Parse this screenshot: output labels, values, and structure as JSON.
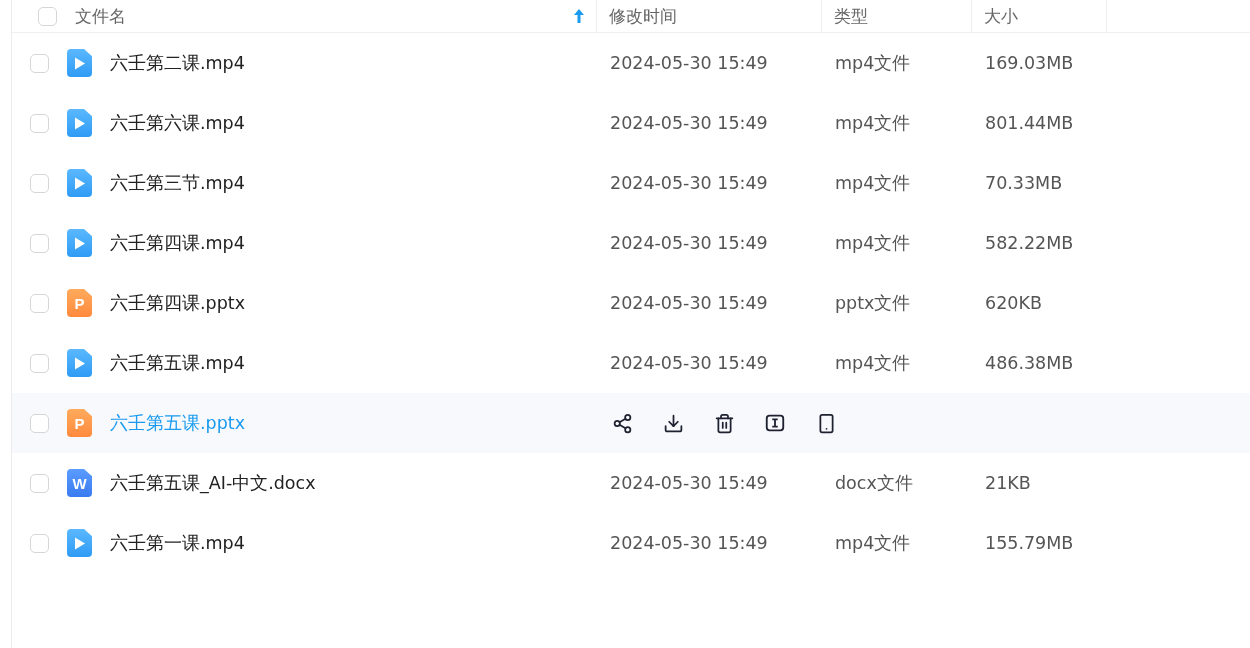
{
  "header": {
    "select_all": {
      "checked": false
    },
    "columns": [
      {
        "label": "文件名",
        "sorted": true
      },
      {
        "label": "修改时间",
        "sorted": false
      },
      {
        "label": "类型",
        "sorted": false
      },
      {
        "label": "大小",
        "sorted": false
      }
    ]
  },
  "files": [
    {
      "kind": "video",
      "name": "六壬第二课.mp4",
      "checked": false,
      "hovered": false,
      "modified": "2024-05-30 15:49",
      "type": "mp4文件",
      "size": "169.03MB"
    },
    {
      "kind": "video",
      "name": "六壬第六课.mp4",
      "checked": false,
      "hovered": false,
      "modified": "2024-05-30 15:49",
      "type": "mp4文件",
      "size": "801.44MB"
    },
    {
      "kind": "video",
      "name": "六壬第三节.mp4",
      "checked": false,
      "hovered": false,
      "modified": "2024-05-30 15:49",
      "type": "mp4文件",
      "size": "70.33MB"
    },
    {
      "kind": "video",
      "name": "六壬第四课.mp4",
      "checked": false,
      "hovered": false,
      "modified": "2024-05-30 15:49",
      "type": "mp4文件",
      "size": "582.22MB"
    },
    {
      "kind": "slides",
      "icon_letter": "P",
      "name": "六壬第四课.pptx",
      "checked": false,
      "hovered": false,
      "modified": "2024-05-30 15:49",
      "type": "pptx文件",
      "size": "620KB"
    },
    {
      "kind": "video",
      "name": "六壬第五课.mp4",
      "checked": false,
      "hovered": false,
      "modified": "2024-05-30 15:49",
      "type": "mp4文件",
      "size": "486.38MB"
    },
    {
      "kind": "slides",
      "icon_letter": "P",
      "name": "六壬第五课.pptx",
      "checked": false,
      "hovered": true,
      "actions": [
        {
          "kind": "share"
        },
        {
          "kind": "download"
        },
        {
          "kind": "delete"
        },
        {
          "kind": "rename"
        },
        {
          "kind": "phone"
        }
      ]
    },
    {
      "kind": "document",
      "icon_letter": "W",
      "name": "六壬第五课_AI-中文.docx",
      "checked": false,
      "hovered": false,
      "modified": "2024-05-30 15:49",
      "type": "docx文件",
      "size": "21KB"
    },
    {
      "kind": "video",
      "name": "六壬第一课.mp4",
      "checked": false,
      "hovered": false,
      "modified": "2024-05-30 15:49",
      "type": "mp4文件",
      "size": "155.79MB"
    }
  ]
}
